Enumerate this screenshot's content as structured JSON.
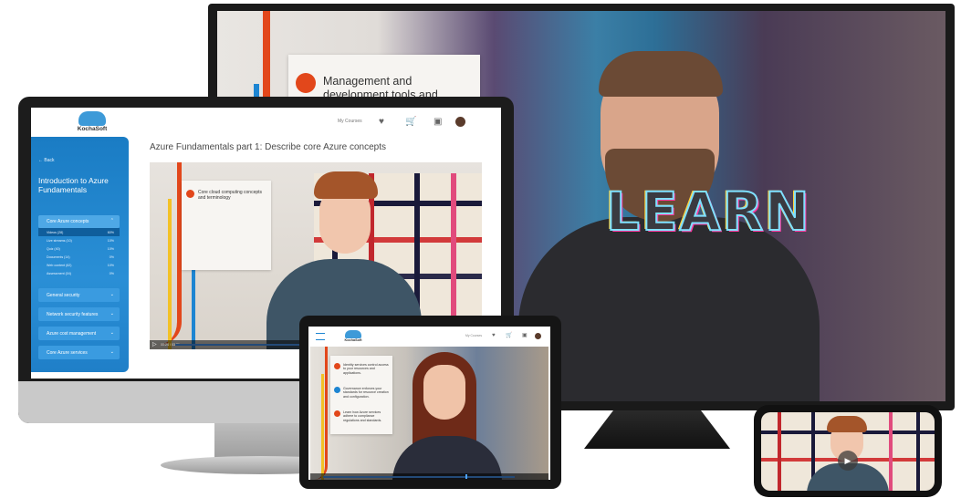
{
  "tv": {
    "slide_text": "Management and development tools and services to make",
    "shirt_text": "LEARN"
  },
  "desktop": {
    "logo_text": "KochaSoft",
    "nav": {
      "my_courses": "My Courses",
      "heart_icon": "heart-icon",
      "cart_icon": "cart-icon",
      "folder_icon": "folder-icon"
    },
    "sidebar": {
      "back": "← Back",
      "course_title": "Introduction to Azure Fundamentals",
      "open_section": "Core Azure concepts",
      "sub_items": [
        {
          "label": "Videos (28)",
          "pct": "60%"
        },
        {
          "label": "Live streams (10)",
          "pct": "10%"
        },
        {
          "label": "Quiz (40)",
          "pct": "10%"
        },
        {
          "label": "Documents (14)",
          "pct": "0%"
        },
        {
          "label": "Web content (62)",
          "pct": "10%"
        },
        {
          "label": "Assessment (04)",
          "pct": "0%"
        }
      ],
      "sections": [
        "General security",
        "Network security features",
        "Azure cost management",
        "Core Azure services"
      ]
    },
    "lesson_title": "Azure Fundamentals part 1: Describe core Azure concepts",
    "video": {
      "card_text": "Core cloud computing concepts and terminology",
      "time": "00:24 / 03:21"
    }
  },
  "tablet": {
    "logo_text": "KochaSoft",
    "my_courses": "My Courses",
    "card_items": [
      {
        "text": "Identity services control access to your resources and applications.",
        "color": "#e2471b"
      },
      {
        "text": "Governance enforces your standards for resource creation and configuration.",
        "color": "#1d85d2"
      },
      {
        "text": "Learn how Azure services adhere to compliance regulations and standards.",
        "color": "#e2471b"
      }
    ]
  },
  "phone": {
    "play_icon": "play-icon"
  }
}
